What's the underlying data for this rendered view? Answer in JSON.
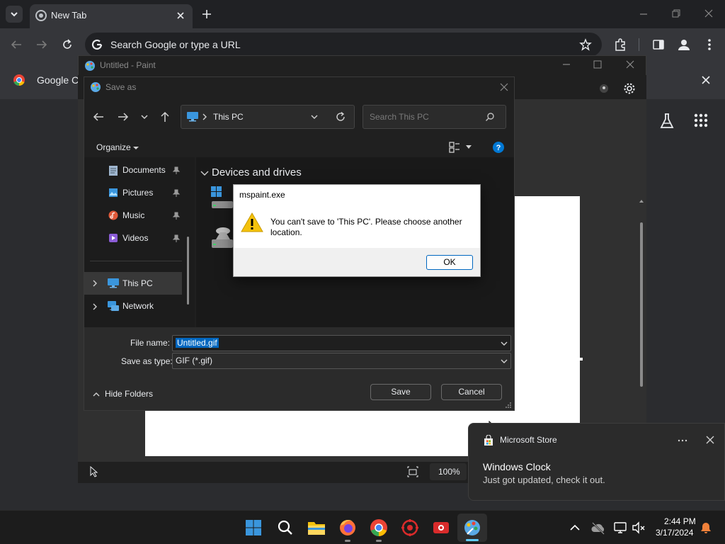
{
  "chrome": {
    "tab_title": "New Tab",
    "omnibox_placeholder": "Search Google or type a URL",
    "ntp_label": "Google Ch"
  },
  "paint": {
    "title": "Untitled - Paint",
    "zoom": "100%"
  },
  "saveas": {
    "title": "Save as",
    "address_location": "This PC",
    "search_placeholder": "Search This PC",
    "organize_label": "Organize",
    "nav": {
      "documents": "Documents",
      "pictures": "Pictures",
      "music": "Music",
      "videos": "Videos",
      "this_pc": "This PC",
      "network": "Network"
    },
    "group_header": "Devices and drives",
    "file_name_label": "File name:",
    "file_name_value": "Untitled.gif",
    "save_type_label": "Save as type:",
    "save_type_value": "GIF (*.gif)",
    "hide_folders_label": "Hide Folders",
    "save_label": "Save",
    "cancel_label": "Cancel"
  },
  "msgbox": {
    "title": "mspaint.exe",
    "message_line1": "You can't save to 'This PC'. Please choose another",
    "message_line2": "location.",
    "ok_label": "OK"
  },
  "toast": {
    "app_name": "Microsoft Store",
    "title": "Windows Clock",
    "body": "Just got updated, check it out."
  },
  "taskbar": {
    "time": "2:44 PM",
    "date": "3/17/2024"
  },
  "colors": {
    "accent_blue": "#0067c0",
    "warning_yellow": "#f4c20d",
    "windows_blue": "#0078d4"
  }
}
